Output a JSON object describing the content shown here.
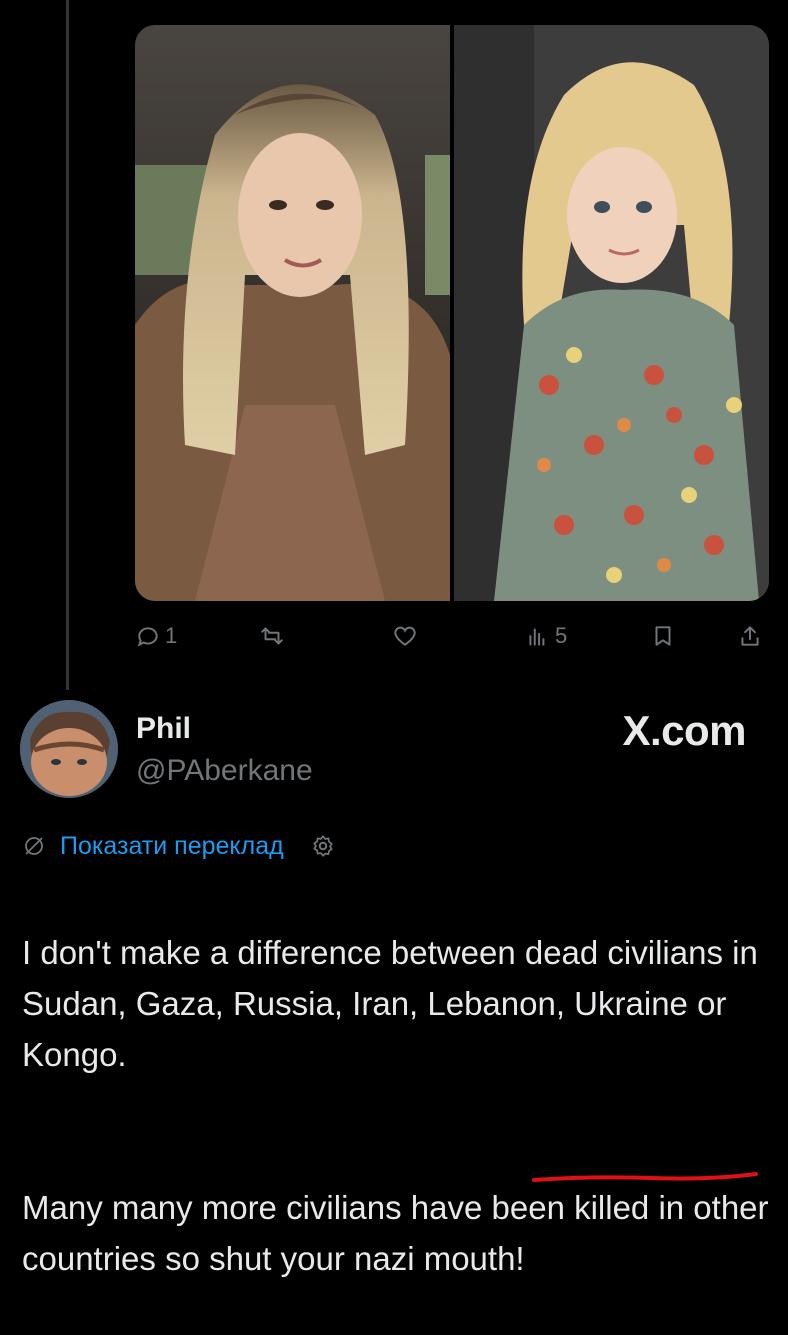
{
  "media": {
    "photos": [
      {
        "description_icon": "photo-woman"
      },
      {
        "description_icon": "photo-child"
      }
    ]
  },
  "actions": {
    "reply_count": "1",
    "views_count": "5"
  },
  "author": {
    "name": "Phil",
    "handle": "@PAberkane"
  },
  "watermark": "X.com",
  "translate": {
    "label": "Показати переклад"
  },
  "tweet": {
    "paragraph1": "I don't make a difference between dead civilians in Sudan, Gaza, Russia, Iran, Lebanon, Ukraine or Kongo.",
    "paragraph2": "Many many more civilians have been killed in other countries so shut your nazi mouth!"
  },
  "colors": {
    "background": "#000000",
    "text": "#e7e9ea",
    "muted": "#71767b",
    "link": "#1d9bf0",
    "underline": "#e0101a"
  }
}
